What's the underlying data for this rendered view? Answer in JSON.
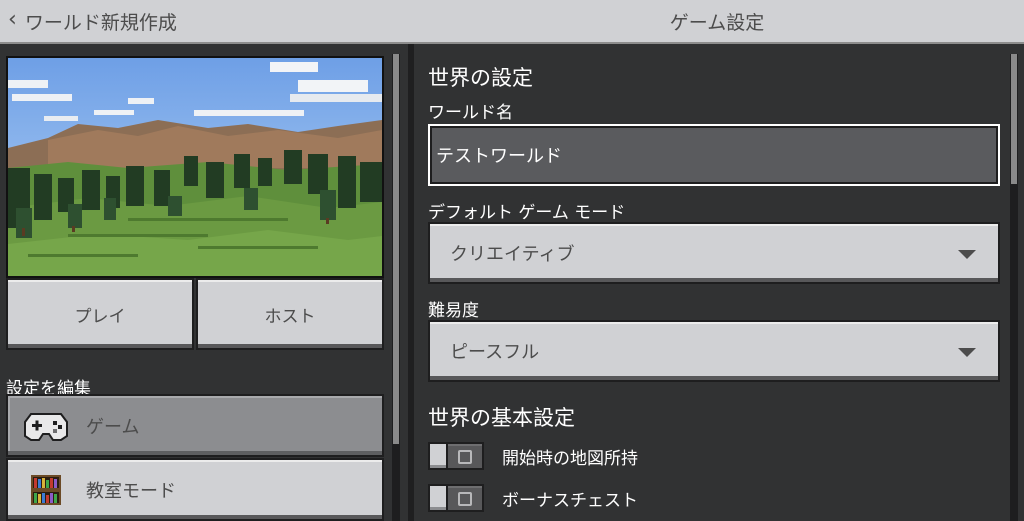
{
  "header": {
    "back_label": "ワールド新規作成",
    "title": "ゲーム設定"
  },
  "left": {
    "play_label": "プレイ",
    "host_label": "ホスト",
    "edit_settings_label": "設定を編集",
    "items": [
      {
        "label": "ゲーム",
        "icon": "gamepad-icon",
        "selected": true
      },
      {
        "label": "教室モード",
        "icon": "bookshelf-icon",
        "selected": false
      }
    ]
  },
  "right": {
    "section_world_settings": "世界の設定",
    "world_name_label": "ワールド名",
    "world_name_value": "テストワールド",
    "default_game_mode_label": "デフォルト ゲーム モード",
    "default_game_mode_value": "クリエイティブ",
    "difficulty_label": "難易度",
    "difficulty_value": "ピースフル",
    "section_world_options": "世界の基本設定",
    "toggles": [
      {
        "label": "開始時の地図所持",
        "on": false
      },
      {
        "label": "ボーナスチェスト",
        "on": false
      }
    ]
  },
  "colors": {
    "background": "#313233",
    "button": "#d0d1d4",
    "selected_item": "#8c8d90",
    "text_dark": "#4c4c4c",
    "text_light": "#ffffff"
  }
}
